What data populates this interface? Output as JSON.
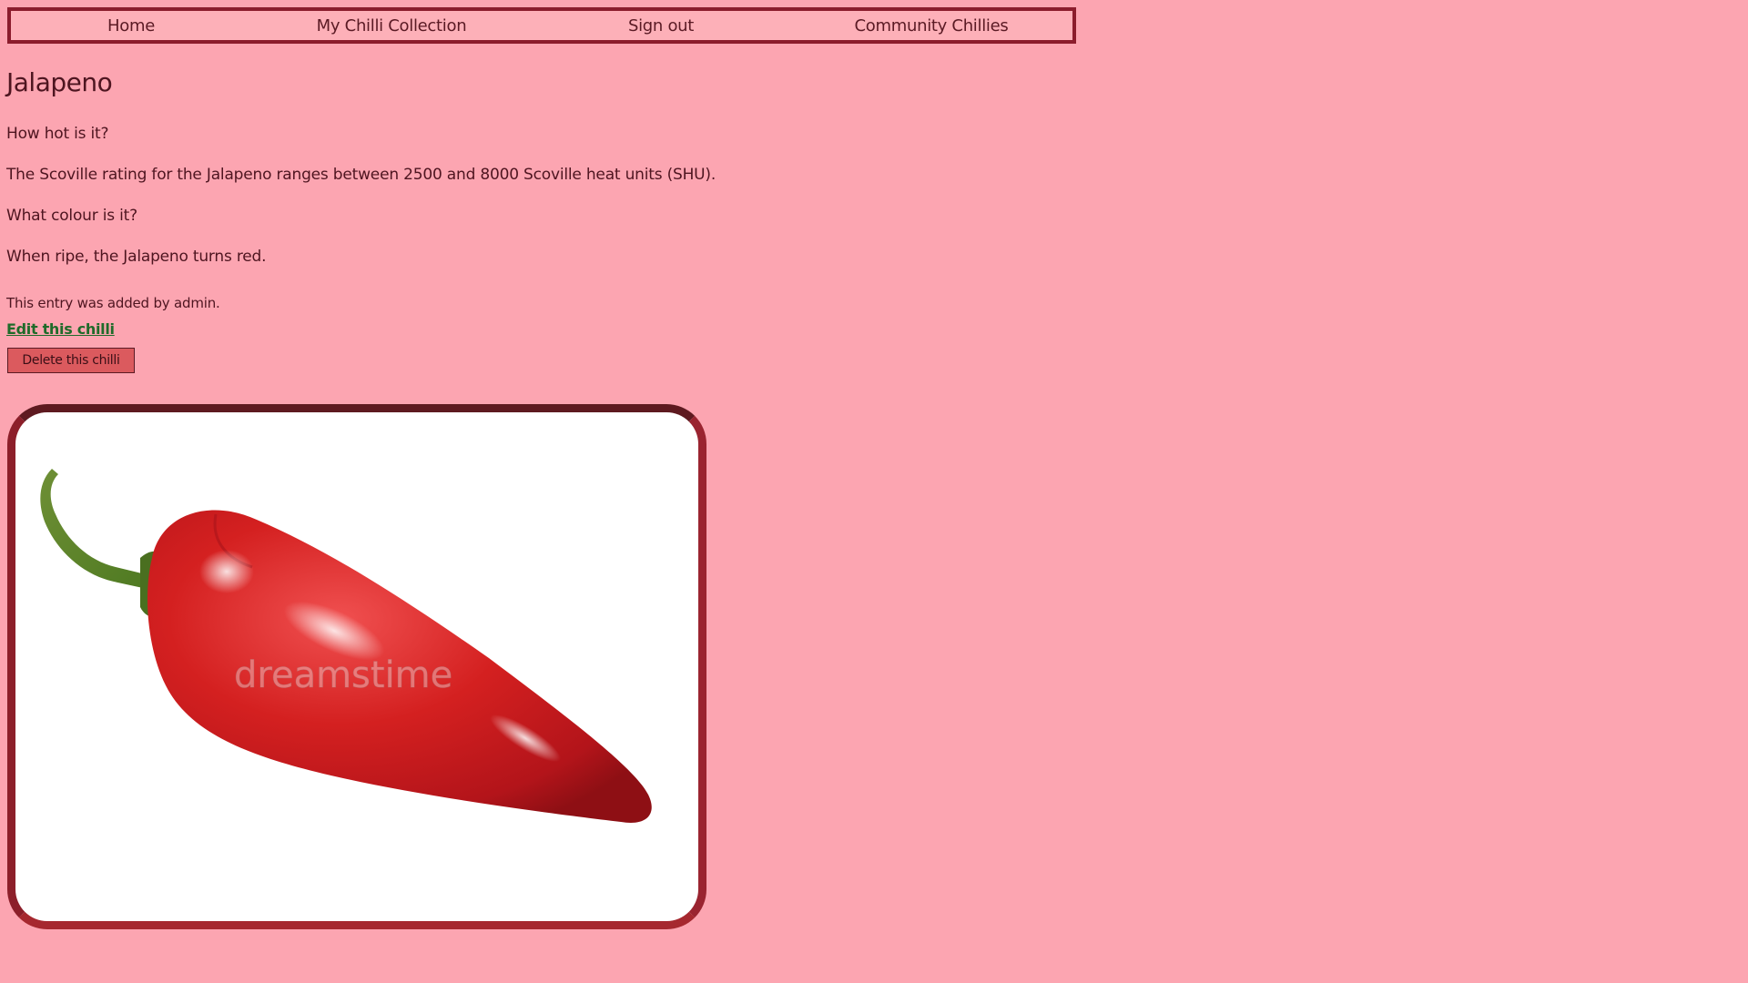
{
  "nav": {
    "home": "Home",
    "collection": "My Chilli Collection",
    "signout": "Sign out",
    "community": "Community Chillies"
  },
  "chilli": {
    "name": "Jalapeno",
    "heat_question": "How hot is it?",
    "heat_answer": "The Scoville rating for the Jalapeno ranges between 2500 and 8000 Scoville heat units (SHU).",
    "colour_question": "What colour is it?",
    "colour_answer": "When ripe, the Jalapeno turns red.",
    "added_by": "This entry was added by admin."
  },
  "actions": {
    "edit_label": "Edit this chilli",
    "delete_label": "Delete this chilli"
  },
  "image": {
    "watermark": "dreamstime"
  },
  "colors": {
    "page_bg": "#fca5b1",
    "nav_border": "#8b1c2c",
    "text": "#4e1520",
    "edit_link": "#1f6b2a",
    "delete_bg": "#db5a5e",
    "pepper_red": "#d42020",
    "stem_green": "#5a8a2a"
  }
}
